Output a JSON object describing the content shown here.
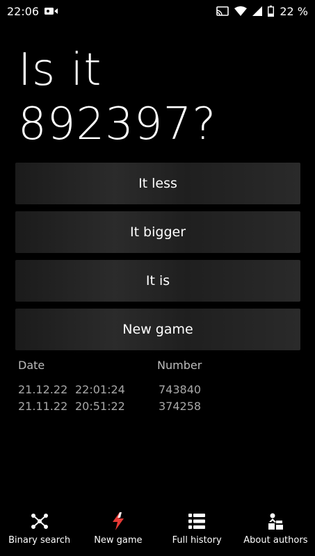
{
  "status_bar": {
    "time": "22:06",
    "battery": "22 %",
    "icons": [
      "video-camera-icon",
      "cast-icon",
      "wifi-icon",
      "signal-icon",
      "battery-icon"
    ]
  },
  "question": {
    "line1": "Is it",
    "line2": "892397?"
  },
  "buttons": {
    "less": "It less",
    "bigger": "It bigger",
    "is": "It is",
    "new_game": "New game"
  },
  "history": {
    "header_date": "Date",
    "header_number": "Number",
    "rows": [
      {
        "date": "21.12.22",
        "time": "22:01:24",
        "number": "743840"
      },
      {
        "date": "21.11.22",
        "time": "20:51:22",
        "number": "374258"
      }
    ]
  },
  "bottom_nav": {
    "items": [
      {
        "label": "Binary search",
        "icon": "binary-search-icon"
      },
      {
        "label": "New game",
        "icon": "lightning-icon"
      },
      {
        "label": "Full history",
        "icon": "list-icon"
      },
      {
        "label": "About authors",
        "icon": "people-icon"
      }
    ],
    "accent": "#e53935"
  }
}
